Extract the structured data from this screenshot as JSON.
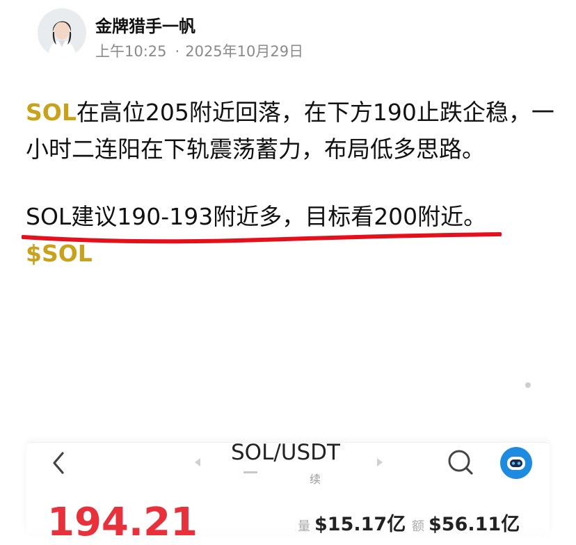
{
  "author": {
    "name": "金牌猎手一帆",
    "time": "上午10:25",
    "separator": "·",
    "date": "2025年10月29日"
  },
  "post": {
    "p1_ticker": "SOL",
    "p1_text": "在高位205附近回落，在下方190止跌企稳，一小时二连阳在下轨震荡蓄力，布局低多思路。",
    "p2_text": "SOL建议190-193附近多，目标看200附近。",
    "p2_cashtag": "$SOL"
  },
  "embedded_chart_card": {
    "pair": "SOL/USDT",
    "subtitle_visible": "续",
    "price": "194.21",
    "stat1_label": "量",
    "stat1_value": "$15.17亿",
    "stat2_label": "额",
    "stat2_value": "$56.11亿"
  },
  "colors": {
    "gold": "#c9a21c",
    "underline": "#e6101d",
    "price_red": "#e8313a",
    "bot_blue": "#1f8be0"
  },
  "icons": [
    "back-chevron-icon",
    "search-icon",
    "bot-icon",
    "prev-arrow-icon",
    "next-arrow-icon"
  ]
}
